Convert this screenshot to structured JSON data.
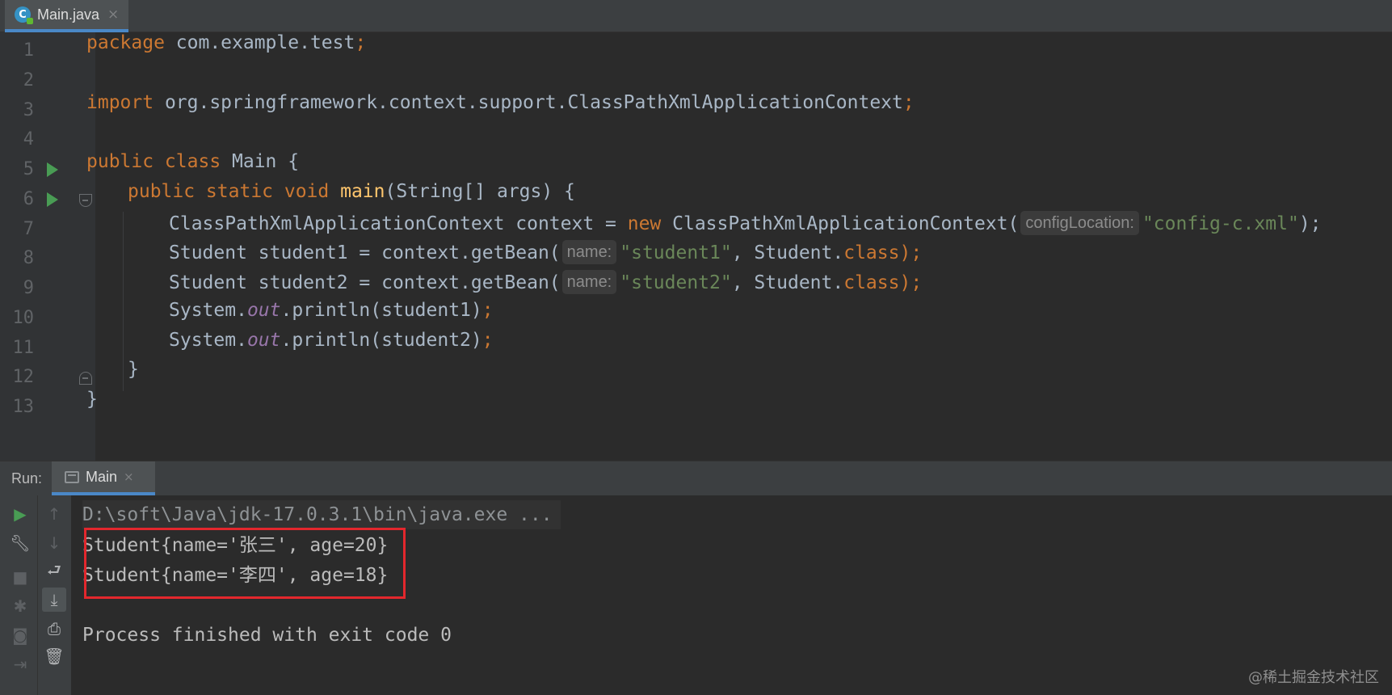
{
  "editor_tab": {
    "label": "Main.java",
    "icon": "java-class-icon",
    "close": "×"
  },
  "code_lines": [
    {
      "num": "1"
    },
    {
      "num": "2"
    },
    {
      "num": "3"
    },
    {
      "num": "4"
    },
    {
      "num": "5"
    },
    {
      "num": "6"
    },
    {
      "num": "7"
    },
    {
      "num": "8"
    },
    {
      "num": "9"
    },
    {
      "num": "10"
    },
    {
      "num": "11"
    },
    {
      "num": "12"
    },
    {
      "num": "13"
    }
  ],
  "code": {
    "l1_kw": "package",
    "l1_rest": " com.example.test",
    "l1_semi": ";",
    "l3_kw": "import",
    "l3_rest": " org.springframework.context.support.ClassPathXmlApplicationContext",
    "l3_semi": ";",
    "l5_kw": "public class",
    "l5_rest": " Main {",
    "l6_kw": "public static void",
    "l6_fn": "main",
    "l6_rest": "(String[] args) {",
    "l7_a": "ClassPathXmlApplicationContext context = ",
    "l7_new": "new",
    "l7_b": " ClassPathXmlApplicationContext(",
    "l7_hint": "configLocation:",
    "l7_str": "\"config-c.xml\"",
    "l7_end": ");",
    "l8_a": "Student student1 = context.getBean(",
    "l8_hint": "name:",
    "l8_str": "\"student1\"",
    "l8_b": ", Student.",
    "l8_kw": "class",
    "l8_end": ");",
    "l9_a": "Student student2 = context.getBean(",
    "l9_hint": "name:",
    "l9_str": "\"student2\"",
    "l9_b": ", Student.",
    "l9_kw": "class",
    "l9_end": ");",
    "l10_a": "System.",
    "l10_field": "out",
    "l10_b": ".println(student1)",
    "l10_semi": ";",
    "l11_a": "System.",
    "l11_field": "out",
    "l11_b": ".println(student2)",
    "l11_semi": ";",
    "l12": "}",
    "l13": "}"
  },
  "run_panel": {
    "title": "Run:",
    "tab_label": "Main",
    "tab_close": "×",
    "output": [
      "D:\\soft\\Java\\jdk-17.0.3.1\\bin\\java.exe ...",
      "Student{name='张三', age=20}",
      "Student{name='李四', age=18}",
      "Process finished with exit code 0"
    ]
  },
  "watermark": "@稀土掘金技术社区",
  "colors": {
    "keyword": "#cc7832",
    "string": "#6a8759",
    "function": "#ffc66d",
    "field": "#9876aa",
    "highlight_box": "#e3272d"
  }
}
